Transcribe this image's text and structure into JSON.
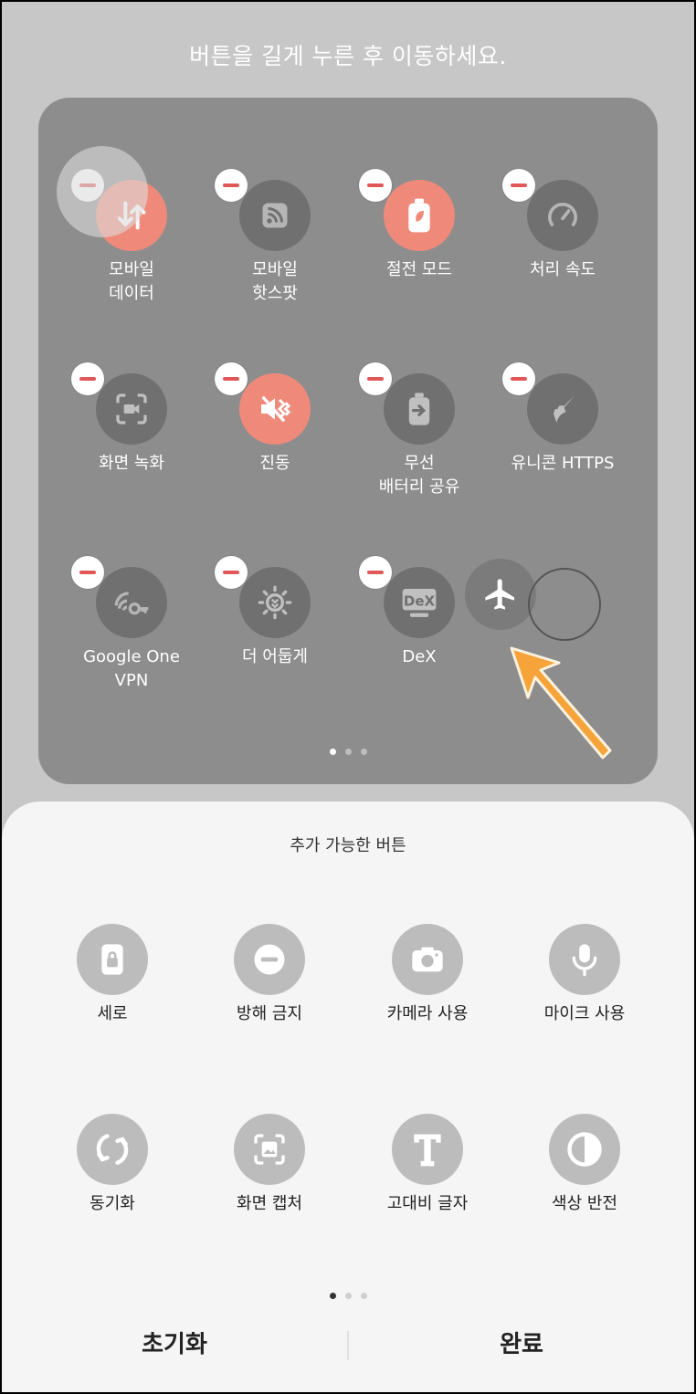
{
  "hint": "버튼을 길게 누른 후 이동하세요.",
  "active_tiles": [
    {
      "label": "모바일\n데이터",
      "icon": "mobile-data-icon",
      "active": true
    },
    {
      "label": "모바일\n핫스팟",
      "icon": "hotspot-icon",
      "active": false
    },
    {
      "label": "절전 모드",
      "icon": "power-saving-icon",
      "active": true
    },
    {
      "label": "처리 속도",
      "icon": "speedometer-icon",
      "active": false
    },
    {
      "label": "화면 녹화",
      "icon": "screen-record-icon",
      "active": false
    },
    {
      "label": "진동",
      "icon": "vibrate-icon",
      "active": true
    },
    {
      "label": "무선\n배터리 공유",
      "icon": "wireless-share-icon",
      "active": false
    },
    {
      "label": "유니콘 HTTPS",
      "icon": "unicorn-icon",
      "active": false
    },
    {
      "label": "Google One\nVPN",
      "icon": "vpn-key-icon",
      "active": false
    },
    {
      "label": "더 어둡게",
      "icon": "extra-dim-icon",
      "active": false
    },
    {
      "label": "DeX",
      "icon": "dex-icon",
      "active": false
    }
  ],
  "dragging": {
    "icon": "airplane-icon"
  },
  "sheet": {
    "title": "추가 가능한 버튼",
    "items": [
      {
        "label": "세로",
        "icon": "portrait-lock-icon"
      },
      {
        "label": "방해 금지",
        "icon": "do-not-disturb-icon"
      },
      {
        "label": "카메라 사용",
        "icon": "camera-icon"
      },
      {
        "label": "마이크 사용",
        "icon": "mic-icon"
      },
      {
        "label": "동기화",
        "icon": "sync-icon"
      },
      {
        "label": "화면 캡처",
        "icon": "screenshot-icon"
      },
      {
        "label": "고대비 글자",
        "icon": "high-contrast-text-icon"
      },
      {
        "label": "색상 반전",
        "icon": "color-inversion-icon"
      }
    ],
    "reset_label": "초기화",
    "done_label": "완료"
  },
  "colors": {
    "accent": "#ef8a7b",
    "remove": "#e15757",
    "arrow": "#f6a43a"
  }
}
